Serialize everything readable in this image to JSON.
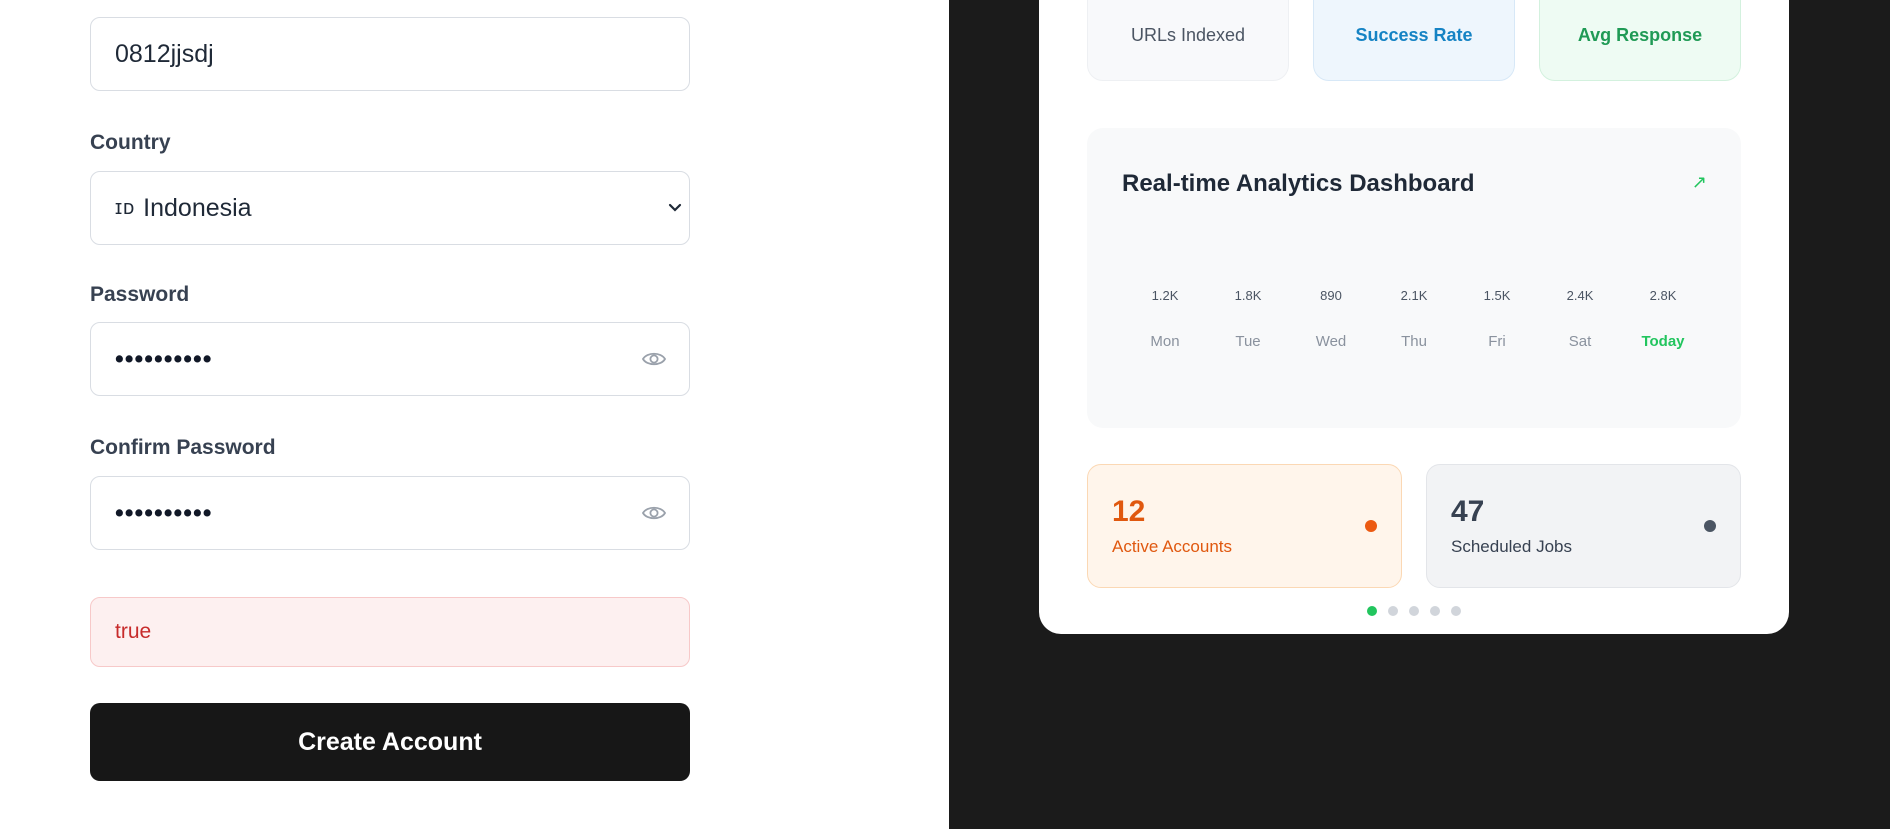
{
  "form": {
    "phone_value": "0812jjsdj",
    "country_label": "Country",
    "country_flag": "ɪᴅ",
    "country_value": "Indonesia",
    "password_label": "Password",
    "password_value": "••••••••••",
    "confirm_label": "Confirm Password",
    "confirm_value": "••••••••••",
    "error_text": "true",
    "submit_label": "Create Account"
  },
  "stats": [
    {
      "caption": "URLs Indexed"
    },
    {
      "caption": "Success Rate"
    },
    {
      "caption": "Avg Response"
    }
  ],
  "analytics": {
    "title": "Real-time Analytics Dashboard",
    "trend_icon": "↗",
    "days": [
      {
        "label": "Mon",
        "value": "1.2K"
      },
      {
        "label": "Tue",
        "value": "1.8K"
      },
      {
        "label": "Wed",
        "value": "890"
      },
      {
        "label": "Thu",
        "value": "2.1K"
      },
      {
        "label": "Fri",
        "value": "1.5K"
      },
      {
        "label": "Sat",
        "value": "2.4K"
      },
      {
        "label": "Today",
        "value": "2.8K"
      }
    ]
  },
  "mini_cards": [
    {
      "value": "12",
      "caption": "Active Accounts"
    },
    {
      "value": "47",
      "caption": "Scheduled Jobs"
    }
  ],
  "pager": {
    "count": 5,
    "active_index": 0
  },
  "colors": {
    "accent_green": "#22c55e",
    "accent_blue": "#1583c4",
    "accent_orange": "#e0580f",
    "button_dark": "#171717",
    "panel_dark": "#1b1b1b"
  }
}
